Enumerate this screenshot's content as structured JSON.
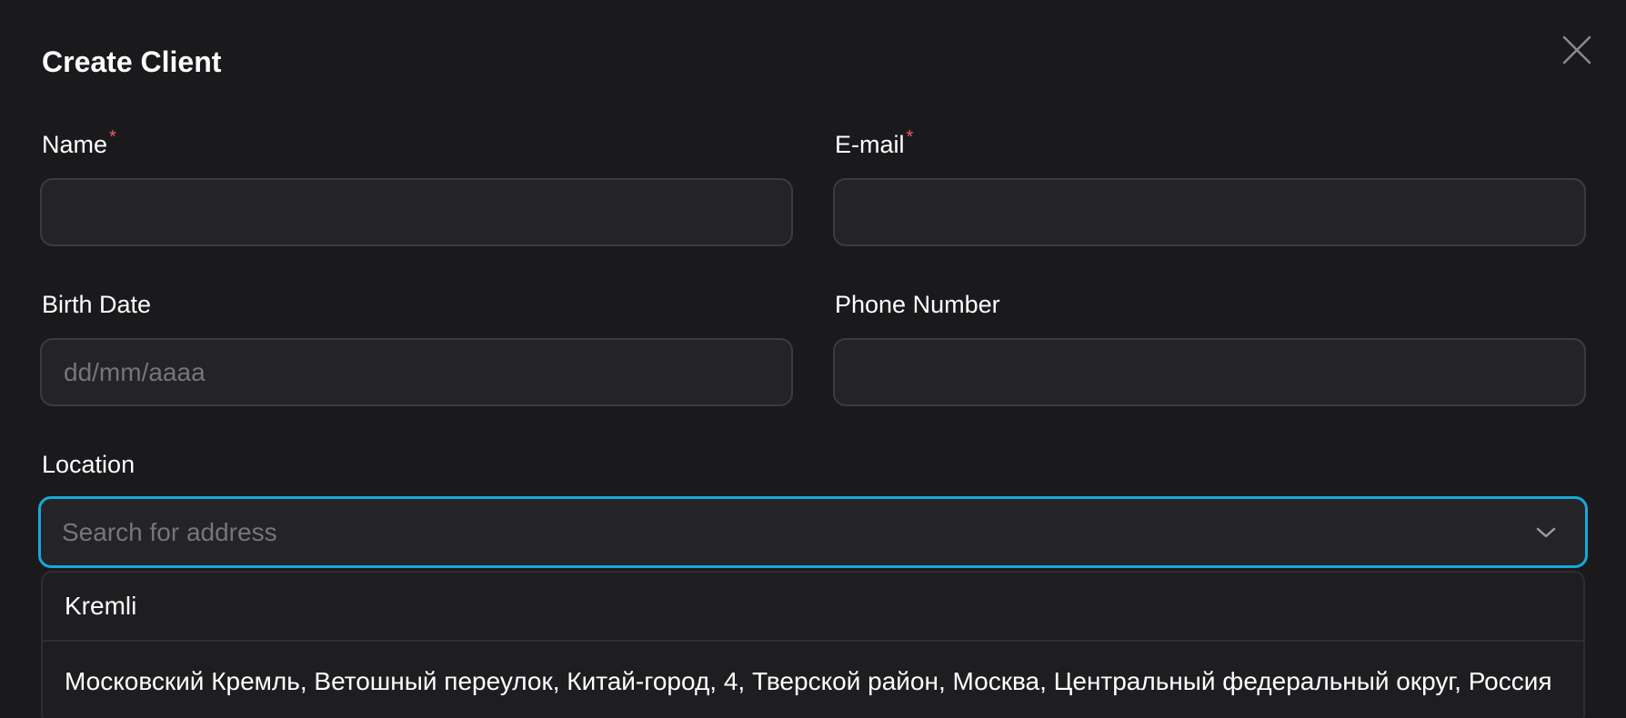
{
  "dialog": {
    "title": "Create Client"
  },
  "form": {
    "name": {
      "label": "Name",
      "required_mark": "*",
      "value": ""
    },
    "email": {
      "label": "E-mail",
      "required_mark": "*",
      "value": ""
    },
    "birth_date": {
      "label": "Birth Date",
      "placeholder": "dd/mm/aaaa",
      "value": ""
    },
    "phone": {
      "label": "Phone Number",
      "value": ""
    },
    "location": {
      "label": "Location",
      "placeholder": "Search for address",
      "options": [
        "Kremli",
        "Московский Кремль, Ветошный переулок, Китай-город, 4, Тверской район, Москва, Центральный федеральный округ, Россия"
      ]
    }
  },
  "colors": {
    "background": "#1a1a1d",
    "input_bg": "#242427",
    "focus_border": "#17a9d8",
    "required": "#ee5b5b"
  },
  "icons": {
    "close": "close-icon",
    "chevron": "chevron-down-icon"
  }
}
